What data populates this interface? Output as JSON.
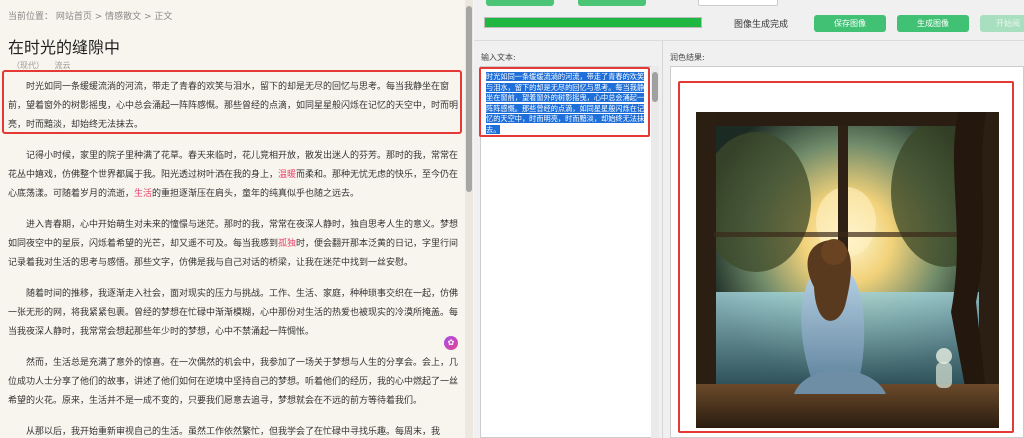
{
  "article": {
    "breadcrumb": "当前位置： 网站首页 > 情感散文 > 正文",
    "title": "在时光的缝隙中",
    "meta_era": "（现代）",
    "meta_author": "流云",
    "paragraphs": [
      {
        "parts": [
          "时光如同一条缓缓流淌的河流，带走了青春的欢笑与泪水，留下的却是无尽的回忆与思考。每当我静坐在窗前，望着窗外的树影摇曳，心中总会涌起一阵阵感慨。那些曾经的点滴，如同星星般闪烁在记忆的天空中，时而明亮，时而黯淡，却始终无法抹去。"
        ]
      },
      {
        "parts": [
          "记得小时候，家里的院子里种满了花草。春天来临时，花儿竞相开放，散发出迷人的芬芳。那时的我，常常在花丛中嬉戏，仿佛整个世界都属于我。阳光透过树叶洒在我的身上，",
          "温暖",
          "而柔和。那种无忧无虑的快乐，至今仍在心底荡漾。可随着岁月的流逝，",
          "生活",
          "的重担逐渐压在肩头，童年的纯真似乎也随之远去。"
        ]
      },
      {
        "parts": [
          "进入青春期，心中开始萌生对未来的憧憬与迷茫。那时的我，常常在夜深人静时，独自思考人生的意义。梦想如同夜空中的星辰，闪烁着希望的光芒，却又遥不可及。每当我感到",
          "孤独",
          "时，便会翻开那本泛黄的日记，字里行间记录着我对生活的思考与感悟。那些文字，仿佛是我与自己对话的桥梁，让我在迷茫中找到一丝安慰。"
        ]
      },
      {
        "parts": [
          "随着时间的推移，我逐渐走入社会，面对现实的压力与挑战。工作、生活、家庭，种种琐事交织在一起，仿佛一张无形的网，将我紧紧包裹。曾经的梦想在忙碌中渐渐模糊，心中那份对生活的热爱也被现实的冷漠所掩盖。每当我夜深人静时，我常常会想起那些年少时的梦想，心中不禁涌起一阵惆怅。"
        ]
      },
      {
        "parts": [
          "然而，生活总是充满了意外的惊喜。在一次偶然的机会中，我参加了一场关于梦想与人生的分享会。会上，几位成功人士分享了他们的故事，讲述了他们如何在逆境中坚持自己的梦想。听着他们的经历，我的心中燃起了一丝希望的火花。原来，生活并不是一成不变的，只要我们愿意去追寻，梦想就会在不远的前方等待着我们。"
        ]
      },
      {
        "parts": [
          "从那以后，我开始重新审视自己的生活。虽然工作依然繁忙，但我学会了在忙碌中寻找乐趣。每周末，我"
        ]
      }
    ]
  },
  "app": {
    "status_text": "图像生成完成",
    "progress": 1.0,
    "buttons": {
      "save": "保存图像",
      "generate": "生成图像",
      "start_reading": "开始阅"
    },
    "input_label": "输入文本:",
    "result_label": "润色结果:",
    "input_text": "时光如同一条缓缓流淌的河流，带走了青春的欢笑与泪水，留下的却是无尽的回忆与思考。每当我静坐在窗前，望着窗外的树影摇曳，心中总会涌起一阵阵感慨。那些曾经的点滴，如同星星般闪烁在记忆的天空中，时而明亮，时而黯淡，却始终无法抹去。"
  },
  "colors": {
    "accent_green": "#41c174",
    "progress_green": "#1fb642",
    "annotation_red": "#e53935",
    "selection_blue": "#1e6fd9",
    "highlight_pink": "#e8456a"
  }
}
